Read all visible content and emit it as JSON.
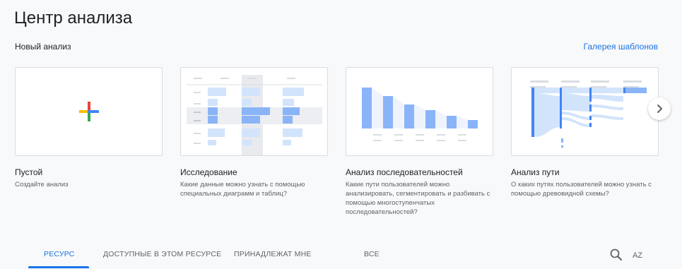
{
  "header": {
    "title": "Центр анализа",
    "new_analysis_label": "Новый анализ",
    "gallery_link": "Галерея шаблонов"
  },
  "cards": [
    {
      "title": "Пустой",
      "description": "Создайте анализ",
      "icon": "plus-icon"
    },
    {
      "title": "Исследование",
      "description": "Какие данные можно узнать с помощью специальных диаграмм и таблиц?",
      "icon": "table-preview"
    },
    {
      "title": "Анализ последовательностей",
      "description": "Какие пути пользователей можно анализировать, сегментировать и разбивать с помощью многоступенчатых последовательностей?",
      "icon": "funnel-preview"
    },
    {
      "title": "Анализ пути",
      "description": "О каких путях пользователей можно узнать с помощью древовидной схемы?",
      "icon": "path-preview"
    }
  ],
  "carousel": {
    "next_icon": "chevron-right-icon"
  },
  "tabs": [
    {
      "label": "Ресурс",
      "active": true
    },
    {
      "label": "Доступные в этом ресурсе",
      "active": false
    },
    {
      "label": "Принадлежат мне",
      "active": false
    },
    {
      "label": "Все",
      "active": false
    }
  ],
  "toolbar": {
    "search_icon": "search-icon",
    "sort_label": "AZ"
  },
  "colors": {
    "accent": "#1a73e8",
    "preview_blue": "#8ab4f8",
    "preview_light_blue": "#d2e3fc",
    "plus_blue": "#4285f4",
    "plus_red": "#ea4335",
    "plus_yellow": "#fbbc04",
    "plus_green": "#34a853"
  }
}
